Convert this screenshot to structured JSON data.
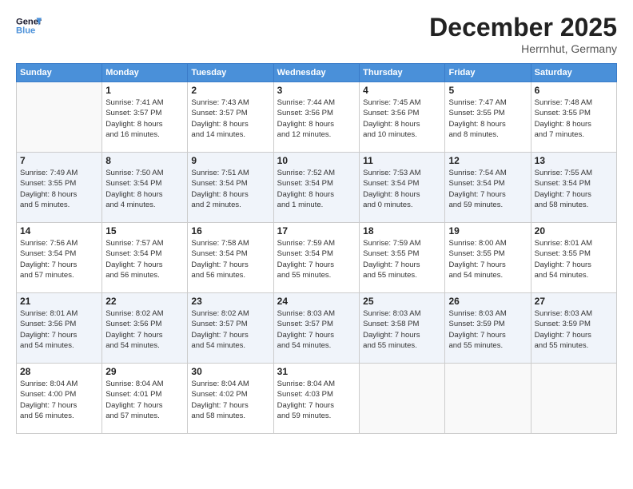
{
  "header": {
    "logo_line1": "General",
    "logo_line2": "Blue",
    "month": "December 2025",
    "location": "Herrnhut, Germany"
  },
  "weekdays": [
    "Sunday",
    "Monday",
    "Tuesday",
    "Wednesday",
    "Thursday",
    "Friday",
    "Saturday"
  ],
  "weeks": [
    [
      {
        "day": "",
        "info": ""
      },
      {
        "day": "1",
        "info": "Sunrise: 7:41 AM\nSunset: 3:57 PM\nDaylight: 8 hours\nand 16 minutes."
      },
      {
        "day": "2",
        "info": "Sunrise: 7:43 AM\nSunset: 3:57 PM\nDaylight: 8 hours\nand 14 minutes."
      },
      {
        "day": "3",
        "info": "Sunrise: 7:44 AM\nSunset: 3:56 PM\nDaylight: 8 hours\nand 12 minutes."
      },
      {
        "day": "4",
        "info": "Sunrise: 7:45 AM\nSunset: 3:56 PM\nDaylight: 8 hours\nand 10 minutes."
      },
      {
        "day": "5",
        "info": "Sunrise: 7:47 AM\nSunset: 3:55 PM\nDaylight: 8 hours\nand 8 minutes."
      },
      {
        "day": "6",
        "info": "Sunrise: 7:48 AM\nSunset: 3:55 PM\nDaylight: 8 hours\nand 7 minutes."
      }
    ],
    [
      {
        "day": "7",
        "info": "Sunrise: 7:49 AM\nSunset: 3:55 PM\nDaylight: 8 hours\nand 5 minutes."
      },
      {
        "day": "8",
        "info": "Sunrise: 7:50 AM\nSunset: 3:54 PM\nDaylight: 8 hours\nand 4 minutes."
      },
      {
        "day": "9",
        "info": "Sunrise: 7:51 AM\nSunset: 3:54 PM\nDaylight: 8 hours\nand 2 minutes."
      },
      {
        "day": "10",
        "info": "Sunrise: 7:52 AM\nSunset: 3:54 PM\nDaylight: 8 hours\nand 1 minute."
      },
      {
        "day": "11",
        "info": "Sunrise: 7:53 AM\nSunset: 3:54 PM\nDaylight: 8 hours\nand 0 minutes."
      },
      {
        "day": "12",
        "info": "Sunrise: 7:54 AM\nSunset: 3:54 PM\nDaylight: 7 hours\nand 59 minutes."
      },
      {
        "day": "13",
        "info": "Sunrise: 7:55 AM\nSunset: 3:54 PM\nDaylight: 7 hours\nand 58 minutes."
      }
    ],
    [
      {
        "day": "14",
        "info": "Sunrise: 7:56 AM\nSunset: 3:54 PM\nDaylight: 7 hours\nand 57 minutes."
      },
      {
        "day": "15",
        "info": "Sunrise: 7:57 AM\nSunset: 3:54 PM\nDaylight: 7 hours\nand 56 minutes."
      },
      {
        "day": "16",
        "info": "Sunrise: 7:58 AM\nSunset: 3:54 PM\nDaylight: 7 hours\nand 56 minutes."
      },
      {
        "day": "17",
        "info": "Sunrise: 7:59 AM\nSunset: 3:54 PM\nDaylight: 7 hours\nand 55 minutes."
      },
      {
        "day": "18",
        "info": "Sunrise: 7:59 AM\nSunset: 3:55 PM\nDaylight: 7 hours\nand 55 minutes."
      },
      {
        "day": "19",
        "info": "Sunrise: 8:00 AM\nSunset: 3:55 PM\nDaylight: 7 hours\nand 54 minutes."
      },
      {
        "day": "20",
        "info": "Sunrise: 8:01 AM\nSunset: 3:55 PM\nDaylight: 7 hours\nand 54 minutes."
      }
    ],
    [
      {
        "day": "21",
        "info": "Sunrise: 8:01 AM\nSunset: 3:56 PM\nDaylight: 7 hours\nand 54 minutes."
      },
      {
        "day": "22",
        "info": "Sunrise: 8:02 AM\nSunset: 3:56 PM\nDaylight: 7 hours\nand 54 minutes."
      },
      {
        "day": "23",
        "info": "Sunrise: 8:02 AM\nSunset: 3:57 PM\nDaylight: 7 hours\nand 54 minutes."
      },
      {
        "day": "24",
        "info": "Sunrise: 8:03 AM\nSunset: 3:57 PM\nDaylight: 7 hours\nand 54 minutes."
      },
      {
        "day": "25",
        "info": "Sunrise: 8:03 AM\nSunset: 3:58 PM\nDaylight: 7 hours\nand 55 minutes."
      },
      {
        "day": "26",
        "info": "Sunrise: 8:03 AM\nSunset: 3:59 PM\nDaylight: 7 hours\nand 55 minutes."
      },
      {
        "day": "27",
        "info": "Sunrise: 8:03 AM\nSunset: 3:59 PM\nDaylight: 7 hours\nand 55 minutes."
      }
    ],
    [
      {
        "day": "28",
        "info": "Sunrise: 8:04 AM\nSunset: 4:00 PM\nDaylight: 7 hours\nand 56 minutes."
      },
      {
        "day": "29",
        "info": "Sunrise: 8:04 AM\nSunset: 4:01 PM\nDaylight: 7 hours\nand 57 minutes."
      },
      {
        "day": "30",
        "info": "Sunrise: 8:04 AM\nSunset: 4:02 PM\nDaylight: 7 hours\nand 58 minutes."
      },
      {
        "day": "31",
        "info": "Sunrise: 8:04 AM\nSunset: 4:03 PM\nDaylight: 7 hours\nand 59 minutes."
      },
      {
        "day": "",
        "info": ""
      },
      {
        "day": "",
        "info": ""
      },
      {
        "day": "",
        "info": ""
      }
    ]
  ]
}
